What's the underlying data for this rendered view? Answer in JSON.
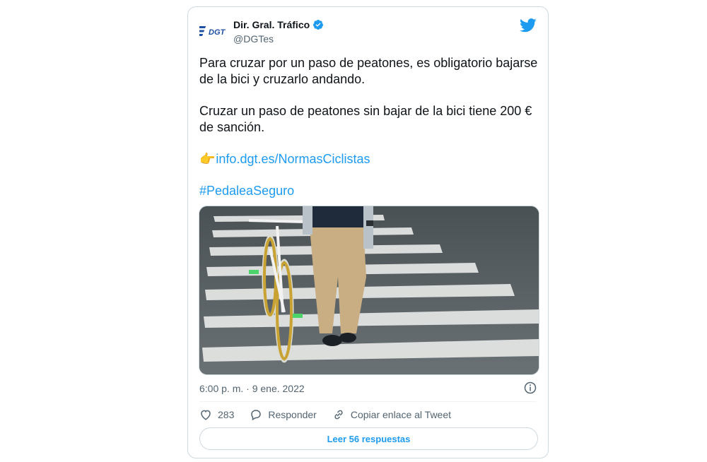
{
  "tweet": {
    "author": {
      "display_name": "Dir. Gral. Tráfico",
      "handle": "@DGTes",
      "verified": true,
      "logo_text": "DGT",
      "logo_color": "#1e4fa3"
    },
    "text": {
      "para1": "Para cruzar por un paso de peatones, es obligatorio bajarse de la bici y cruzarlo andando.",
      "para2": "Cruzar un paso de peatones sin bajar de la bici tiene 200 € de sanción.",
      "link_emoji": "👉",
      "link": "info.dgt.es/NormasCiclistas",
      "hashtag": "#PedaleaSeguro"
    },
    "media": {
      "description_icon": "photo-person-walking-bike-on-crosswalk"
    },
    "timestamp": "6:00 p. m. · 9 ene. 2022",
    "actions": {
      "like_count": "283",
      "reply_label": "Responder",
      "copy_link_label": "Copiar enlace al Tweet"
    },
    "read_replies_label": "Leer 56 respuestas"
  },
  "colors": {
    "accent": "#1d9bf0",
    "secondary_text": "#536471",
    "primary_text": "#0f1419",
    "border": "#cfd9de"
  }
}
